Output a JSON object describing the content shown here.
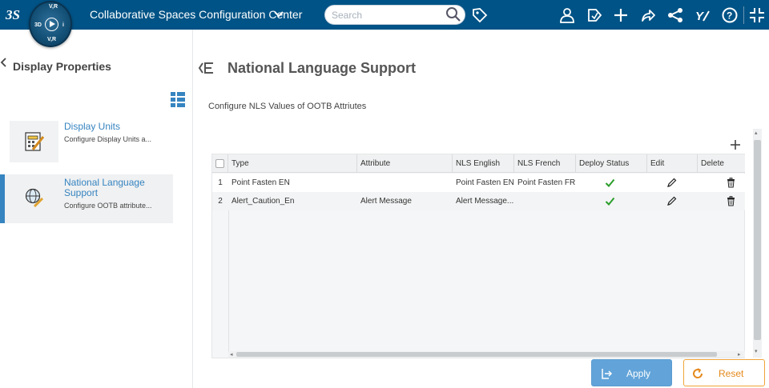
{
  "header": {
    "app_title": "Collaborative Spaces Configuration Center",
    "search_placeholder": "Search",
    "compass": {
      "top": "V,R",
      "left": "3D",
      "right": "i",
      "bottom": "V,R"
    },
    "icons": [
      "user-icon",
      "tag-icon",
      "plus-icon",
      "share-icon",
      "network-icon",
      "compass-y-icon",
      "help-icon",
      "collapse-icon"
    ]
  },
  "sidebar": {
    "title": "Display Properties",
    "items": [
      {
        "title": "Display Units",
        "description": "Configure Display Units a...",
        "selected": false
      },
      {
        "title": "National Language Support",
        "description": "Configure OOTB attribute...",
        "selected": true
      }
    ]
  },
  "main": {
    "title": "National Language Support",
    "subtitle": "Configure NLS Values of OOTB Attriutes",
    "table": {
      "columns": [
        "Type",
        "Attribute",
        "NLS English",
        "NLS French",
        "Deploy Status",
        "Edit",
        "Delete"
      ],
      "rows": [
        {
          "num": "1",
          "type": "Point Fasten EN",
          "attribute": "",
          "nls_english": "Point Fasten EN",
          "nls_french": "Point Fasten FR",
          "deployed": true
        },
        {
          "num": "2",
          "type": "Alert_Caution_En",
          "attribute": "Alert Message",
          "nls_english": "Alert Message...",
          "nls_french": "",
          "deployed": true
        }
      ]
    }
  },
  "footer": {
    "apply_label": "Apply",
    "reset_label": "Reset"
  },
  "colors": {
    "topbar": "#005386",
    "accent": "#3684c0",
    "apply": "#62a4d9",
    "reset": "#e5891c",
    "check": "#2a9d2a"
  }
}
